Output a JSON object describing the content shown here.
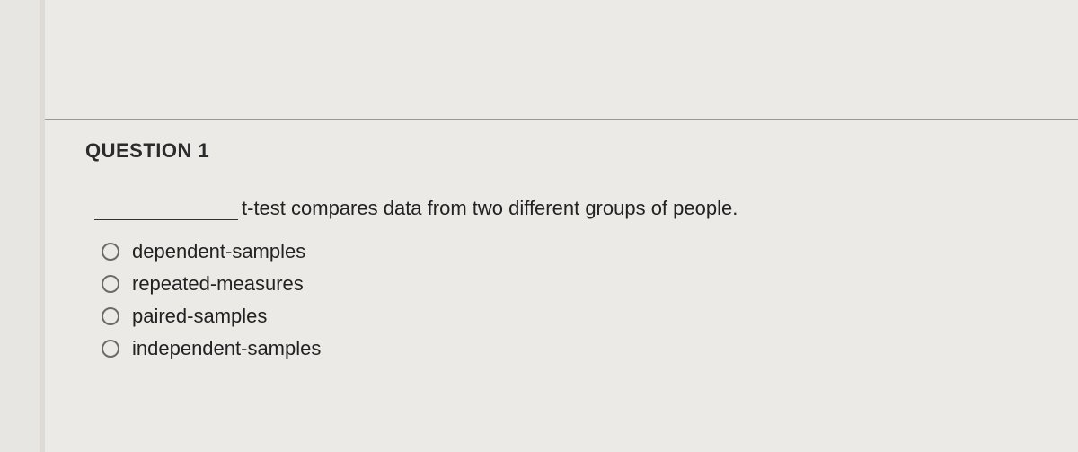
{
  "question": {
    "title": "QUESTION 1",
    "prompt_suffix": "t-test compares data from two different groups of people.",
    "options": [
      {
        "label": "dependent-samples"
      },
      {
        "label": "repeated-measures"
      },
      {
        "label": "paired-samples"
      },
      {
        "label": "independent-samples"
      }
    ]
  }
}
